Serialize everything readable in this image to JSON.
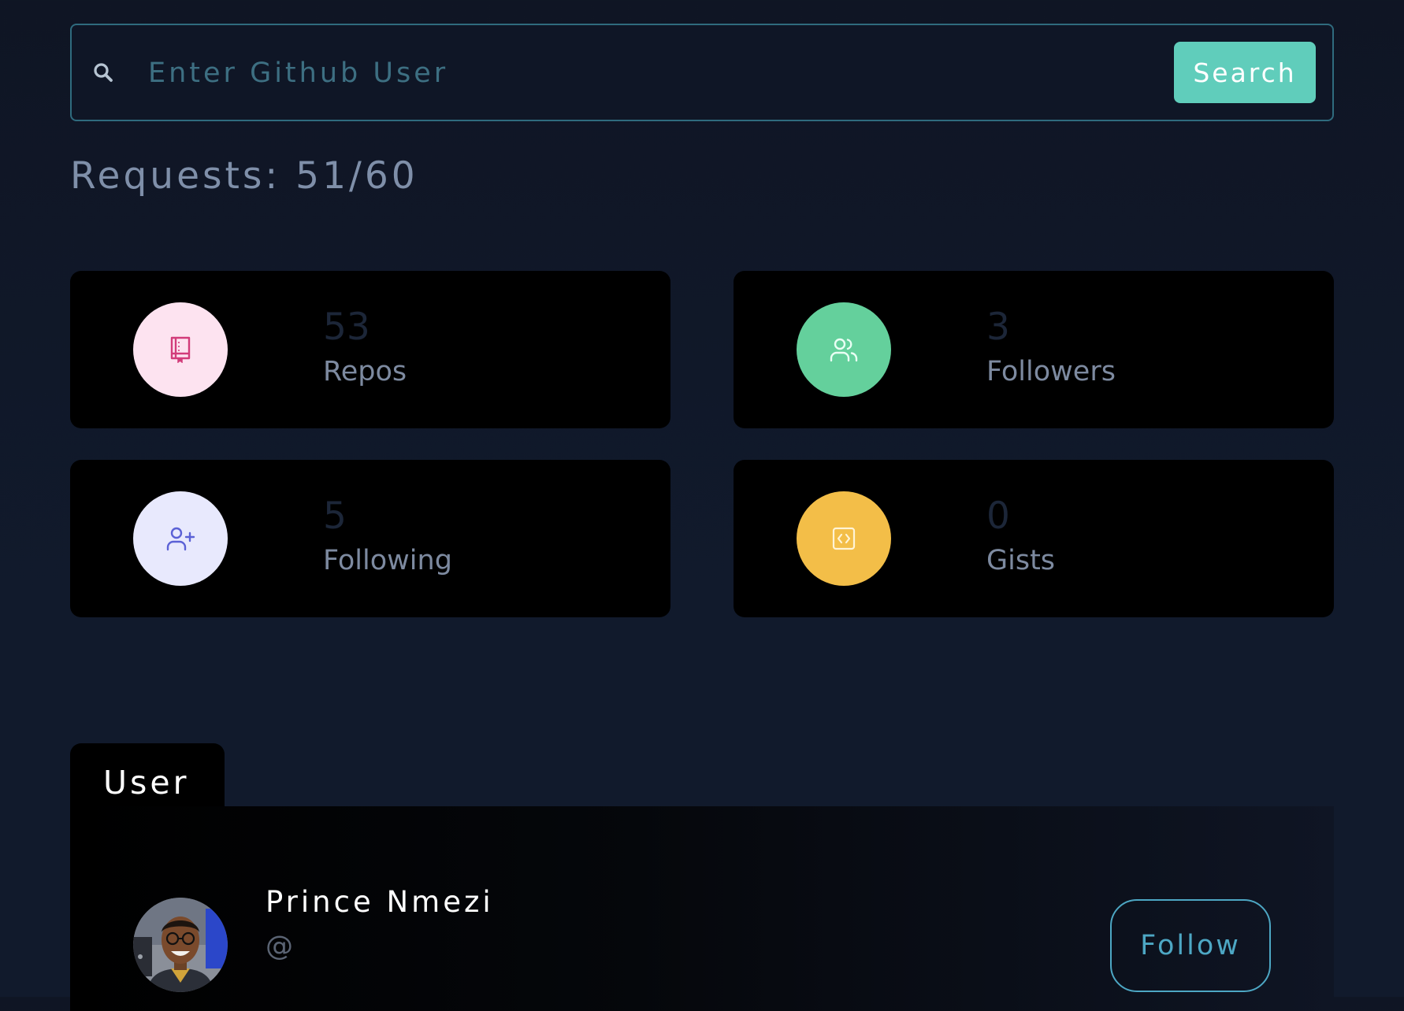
{
  "search": {
    "placeholder": "Enter Github User",
    "value": "",
    "button_label": "Search"
  },
  "requests": {
    "text": "Requests: 51/60",
    "used": 51,
    "limit": 60
  },
  "stats": {
    "repos": {
      "value": "53",
      "label": "Repos",
      "icon": "repo-book-icon",
      "circle_color": "#fde3f0",
      "icon_color": "#d23c7a"
    },
    "followers": {
      "value": "3",
      "label": "Followers",
      "icon": "users-icon",
      "circle_color": "#64d09c",
      "icon_color": "#e9fff4"
    },
    "following": {
      "value": "5",
      "label": "Following",
      "icon": "user-plus-icon",
      "circle_color": "#e8e9fd",
      "icon_color": "#5b61d6"
    },
    "gists": {
      "value": "0",
      "label": "Gists",
      "icon": "code-icon",
      "circle_color": "#f3be48",
      "icon_color": "#fff4d6"
    }
  },
  "user_card": {
    "tab_label": "User",
    "name": "Prince Nmezi",
    "handle": "@",
    "follow_label": "Follow",
    "avatar": "avatar-photo"
  },
  "colors": {
    "background": "#111a2c",
    "accent": "#60cdbb",
    "follow_accent": "#4da7c4",
    "card": "#000000"
  }
}
